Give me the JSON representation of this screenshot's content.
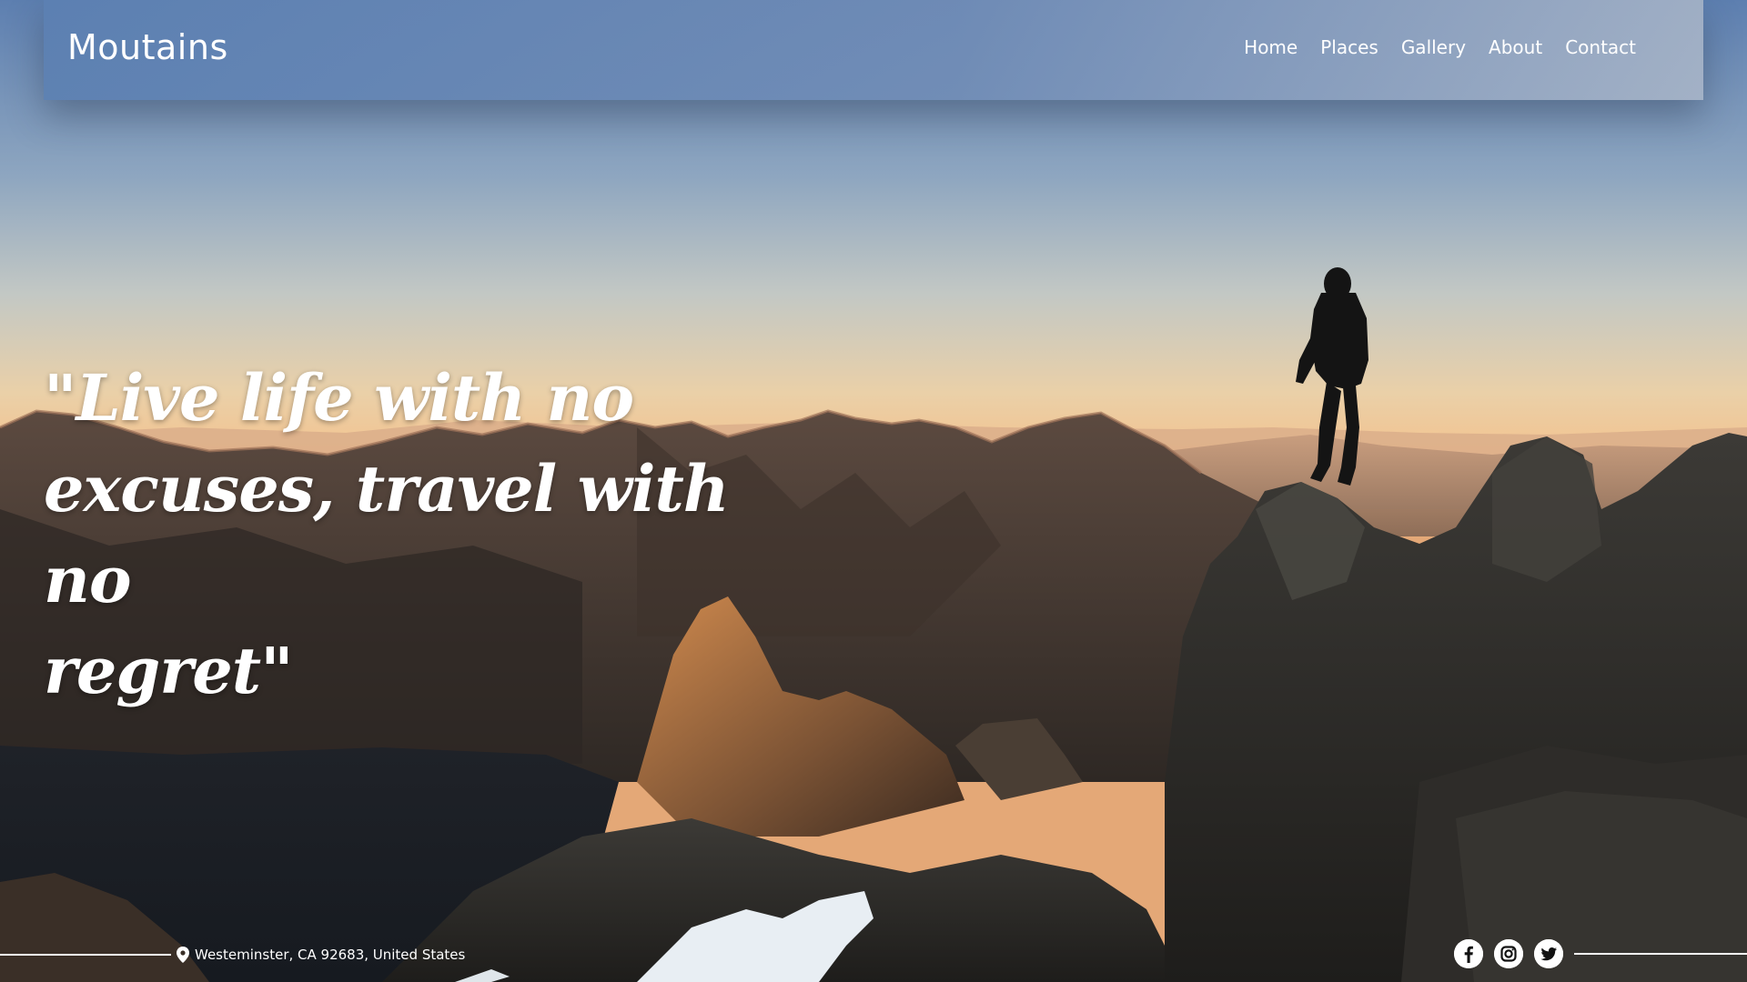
{
  "brand": {
    "name": "Moutains"
  },
  "nav": {
    "items": [
      {
        "label": "Home",
        "icon": "none"
      },
      {
        "label": "Places",
        "icon": "none"
      },
      {
        "label": "Gallery",
        "icon": "none"
      },
      {
        "label": "About",
        "icon": "none"
      },
      {
        "label": "Contact",
        "icon": "none"
      }
    ]
  },
  "hero": {
    "quote_line_1": "\"Live life with no",
    "quote_line_2": "excuses, travel with no",
    "quote_line_3": "regret\""
  },
  "footer": {
    "address": "Westeminster, CA 92683, United States",
    "address_icon": "map-pin-icon",
    "social": [
      {
        "name": "facebook",
        "icon": "facebook-icon"
      },
      {
        "name": "instagram",
        "icon": "instagram-icon"
      },
      {
        "name": "twitter",
        "icon": "twitter-icon"
      }
    ]
  },
  "colors": {
    "navbar": "#5f82b4",
    "text": "#ffffff",
    "sky_top": "#5d7fb0",
    "sky_horizon": "#f2c28e",
    "mountain_dark": "#2a2520"
  }
}
